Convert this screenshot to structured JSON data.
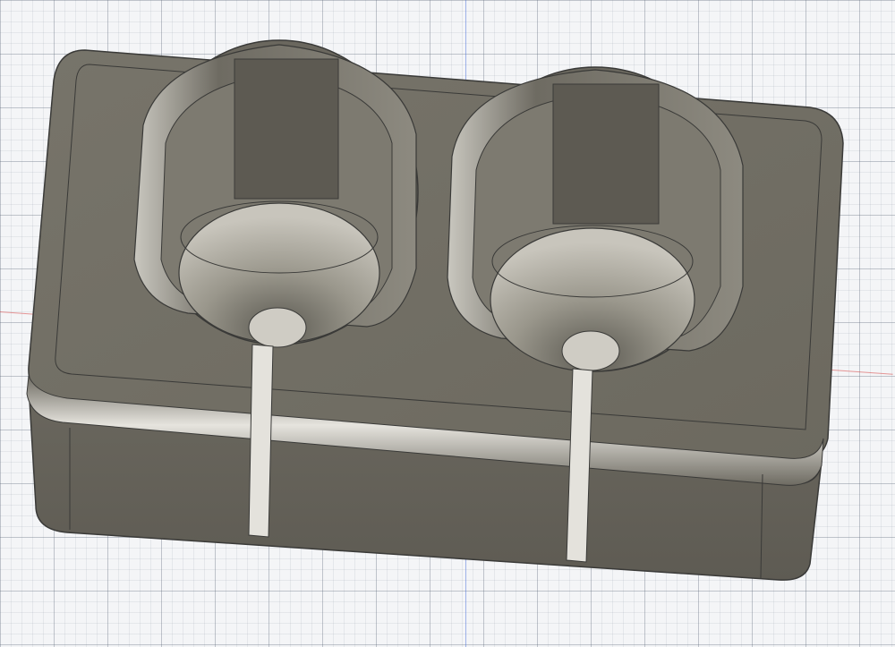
{
  "viewport": {
    "grid_color": "#b7bcc6",
    "background_color": "#f4f5f7",
    "x_axis_color": "#d74646",
    "y_axis_color": "#466edc"
  },
  "model": {
    "material_color": "#8e8a7c",
    "edge_color": "#3a3a38",
    "cup_count": 2
  }
}
